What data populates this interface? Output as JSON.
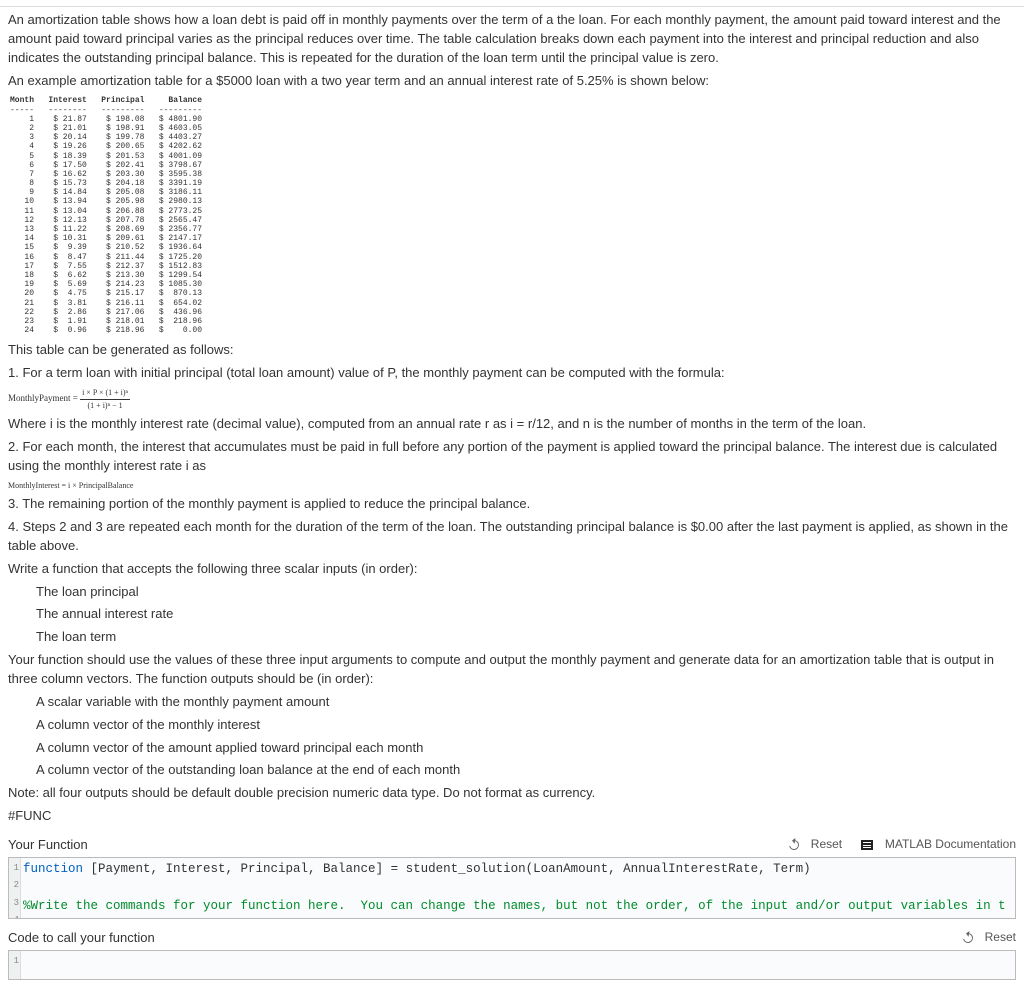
{
  "text": {
    "p1": "An amortization table shows how a loan debt is paid off in monthly payments over the term of a the loan. For each monthly payment, the amount paid toward interest and the amount paid toward principal varies as the principal reduces over time. The table calculation breaks down each payment into the interest and principal reduction and also indicates the outstanding principal balance. This is repeated for the duration of the loan term until the principal value is zero.",
    "p2": "An example amortization table for a $5000 loan with a two year term and an annual interest rate of 5.25% is shown below:",
    "p3": "This table can be generated as follows:",
    "step1": "1. For a term loan with initial principal (total loan amount) value of P, the monthly payment can be computed with the formula:",
    "formula1_lhs": "MonthlyPayment =",
    "formula1_num": "i × P × (1 + i)ⁿ",
    "formula1_den": "(1 + i)ⁿ − 1",
    "step1b": "Where i is the monthly interest rate (decimal value), computed from an annual rate r as i = r/12, and n is the number of months in the term of the loan.",
    "step2": "2. For each month, the interest that accumulates must be paid in full before any portion of the payment is applied toward the principal balance. The interest due is calculated using the monthly interest rate i as",
    "formula2": "MonthlyInterest = i × PrincipalBalance",
    "step3": "3. The remaining portion of the monthly payment is applied to reduce the principal balance.",
    "step4": "4. Steps 2 and 3 are repeated each month for the duration of the term of the loan. The outstanding principal balance is $0.00 after the last payment is applied, as shown in the table above.",
    "p4": "Write a function that accepts the following three scalar inputs (in order):",
    "in1": "The loan principal",
    "in2": "The annual interest rate",
    "in3": "The loan term",
    "p5": "Your function should use the values of these three input arguments to compute and output the monthly payment and generate data for an amortization table that is output in three column vectors. The function outputs should be (in order):",
    "out1": "A scalar variable with the monthly payment amount",
    "out2": "A column vector of the monthly interest",
    "out3": "A column vector of the amount applied toward principal each month",
    "out4": "A column vector of the outstanding loan balance at the end of each month",
    "note": "Note: all four outputs should be default double precision numeric data type. Do not format as currency.",
    "func": "#FUNC",
    "your_function": "Your Function",
    "code_to_call": "Code to call your function",
    "reset": "Reset",
    "matlab_doc": "MATLAB Documentation"
  },
  "amort_table": {
    "headers": [
      "Month",
      "Interest",
      "Principal",
      "Balance"
    ],
    "rows": [
      [
        "1",
        "$ 21.87",
        "$ 198.08",
        "$ 4801.90"
      ],
      [
        "2",
        "$ 21.01",
        "$ 198.91",
        "$ 4603.05"
      ],
      [
        "3",
        "$ 20.14",
        "$ 199.78",
        "$ 4403.27"
      ],
      [
        "4",
        "$ 19.26",
        "$ 200.65",
        "$ 4202.62"
      ],
      [
        "5",
        "$ 18.39",
        "$ 201.53",
        "$ 4001.09"
      ],
      [
        "6",
        "$ 17.50",
        "$ 202.41",
        "$ 3798.67"
      ],
      [
        "7",
        "$ 16.62",
        "$ 203.30",
        "$ 3595.38"
      ],
      [
        "8",
        "$ 15.73",
        "$ 204.18",
        "$ 3391.19"
      ],
      [
        "9",
        "$ 14.84",
        "$ 205.08",
        "$ 3186.11"
      ],
      [
        "10",
        "$ 13.94",
        "$ 205.98",
        "$ 2980.13"
      ],
      [
        "11",
        "$ 13.04",
        "$ 206.88",
        "$ 2773.25"
      ],
      [
        "12",
        "$ 12.13",
        "$ 207.78",
        "$ 2565.47"
      ],
      [
        "13",
        "$ 11.22",
        "$ 208.69",
        "$ 2356.77"
      ],
      [
        "14",
        "$ 10.31",
        "$ 209.61",
        "$ 2147.17"
      ],
      [
        "15",
        "$  9.39",
        "$ 210.52",
        "$ 1936.64"
      ],
      [
        "16",
        "$  8.47",
        "$ 211.44",
        "$ 1725.20"
      ],
      [
        "17",
        "$  7.55",
        "$ 212.37",
        "$ 1512.83"
      ],
      [
        "18",
        "$  6.62",
        "$ 213.30",
        "$ 1299.54"
      ],
      [
        "19",
        "$  5.69",
        "$ 214.23",
        "$ 1085.30"
      ],
      [
        "20",
        "$  4.75",
        "$ 215.17",
        "$  870.13"
      ],
      [
        "21",
        "$  3.81",
        "$ 216.11",
        "$  654.02"
      ],
      [
        "22",
        "$  2.86",
        "$ 217.06",
        "$  436.96"
      ],
      [
        "23",
        "$  1.91",
        "$ 218.01",
        "$  218.96"
      ],
      [
        "24",
        "$  0.96",
        "$ 218.96",
        "$    0.00"
      ]
    ]
  },
  "code": {
    "line1_pre": "function",
    "line1_mid": " [Payment, Interest, Principal, Balance] = student_solution(LoanAmount, AnnualInterestRate, Term)",
    "line3": "%Write the commands for your function here.  You can change the names, but not the order, of the input and/or output variables in t"
  }
}
